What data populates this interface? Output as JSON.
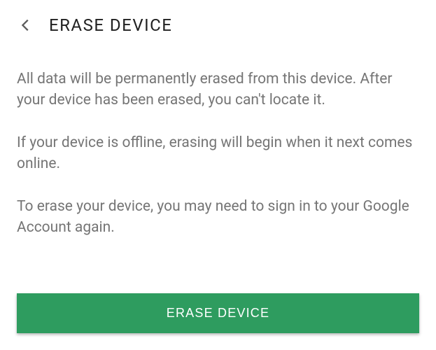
{
  "header": {
    "title": "ERASE DEVICE"
  },
  "content": {
    "paragraph1": "All data will be permanently erased from this device. After your device has been erased, you can't locate it.",
    "paragraph2": "If your device is offline, erasing will begin when it next comes online.",
    "paragraph3": "To erase your device, you may need to sign in to your Google Account again."
  },
  "footer": {
    "button_label": "ERASE DEVICE"
  },
  "colors": {
    "primary_button": "#2e9c5f",
    "text_muted": "#757575",
    "text_heading": "#212121"
  }
}
